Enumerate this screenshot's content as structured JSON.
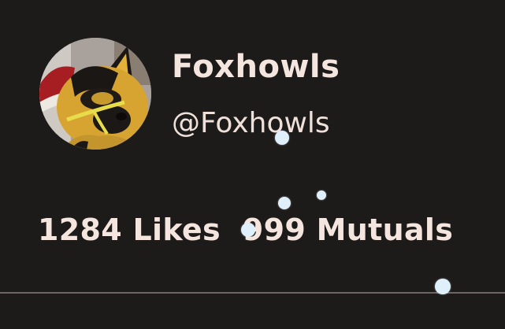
{
  "profile": {
    "display_name": "Foxhowls",
    "handle": "@Foxhowls",
    "avatar_icon": "fox-fursuit-avatar"
  },
  "stats": {
    "likes_count": "1284",
    "likes_label": "Likes",
    "mutuals_count": "999",
    "mutuals_label": "Mutuals"
  },
  "colors": {
    "background": "#1c1b1a",
    "text": "#f4e6de",
    "divider": "#6d6562",
    "dot": "#e0f0fb"
  }
}
